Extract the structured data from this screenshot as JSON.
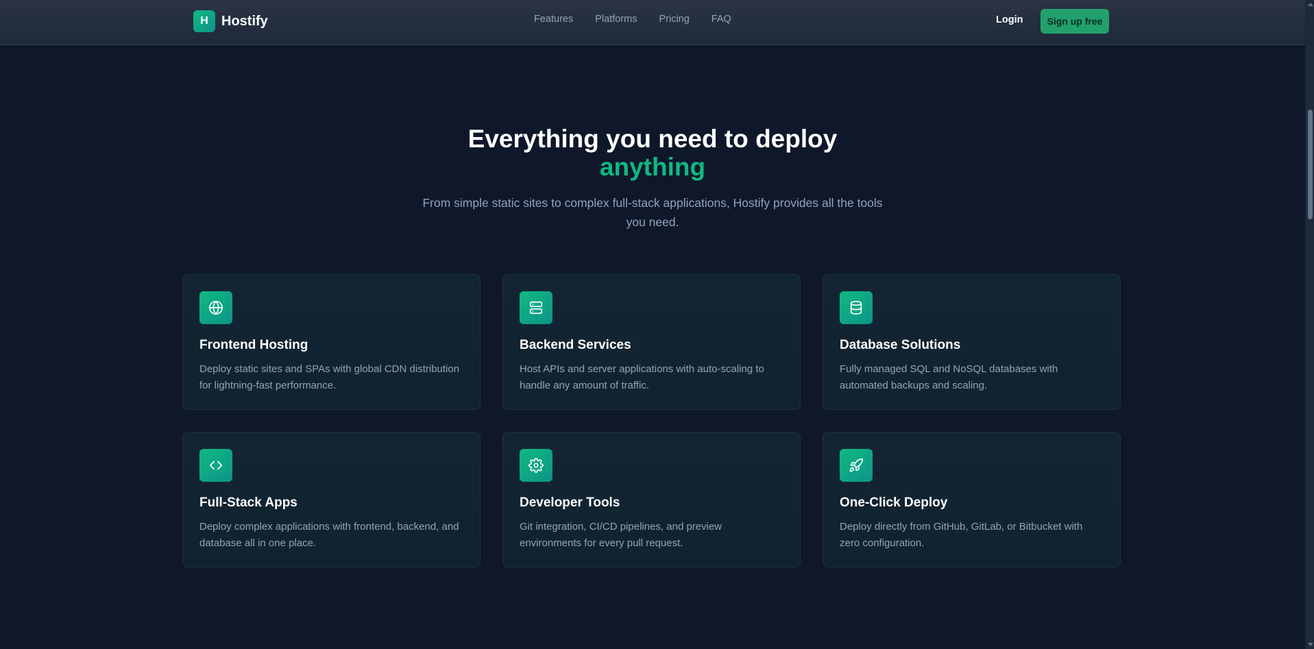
{
  "nav": {
    "logo_letter": "H",
    "brand": "Hostify",
    "links": [
      "Features",
      "Platforms",
      "Pricing",
      "FAQ"
    ],
    "login": "Login",
    "signup": "Sign up free"
  },
  "hero": {
    "title": "Everything you need to deploy",
    "title_accent": "anything",
    "subtitle": "From simple static sites to complex full-stack applications, Hostify provides all the tools you need."
  },
  "features": [
    {
      "icon": "globe-icon",
      "title": "Frontend Hosting",
      "description": "Deploy static sites and SPAs with global CDN distribution for lightning-fast performance."
    },
    {
      "icon": "server-icon",
      "title": "Backend Services",
      "description": "Host APIs and server applications with auto-scaling to handle any amount of traffic."
    },
    {
      "icon": "database-icon",
      "title": "Database Solutions",
      "description": "Fully managed SQL and NoSQL databases with automated backups and scaling."
    },
    {
      "icon": "code-icon",
      "title": "Full-Stack Apps",
      "description": "Deploy complex applications with frontend, backend, and database all in one place."
    },
    {
      "icon": "gear-icon",
      "title": "Developer Tools",
      "description": "Git integration, CI/CD pipelines, and preview environments for every pull request."
    },
    {
      "icon": "rocket-icon",
      "title": "One-Click Deploy",
      "description": "Deploy directly from GitHub, GitLab, or Bitbucket with zero configuration."
    }
  ],
  "colors": {
    "background": "#0f172a",
    "accent": "#10b981",
    "signup_button": "#22a06b"
  }
}
